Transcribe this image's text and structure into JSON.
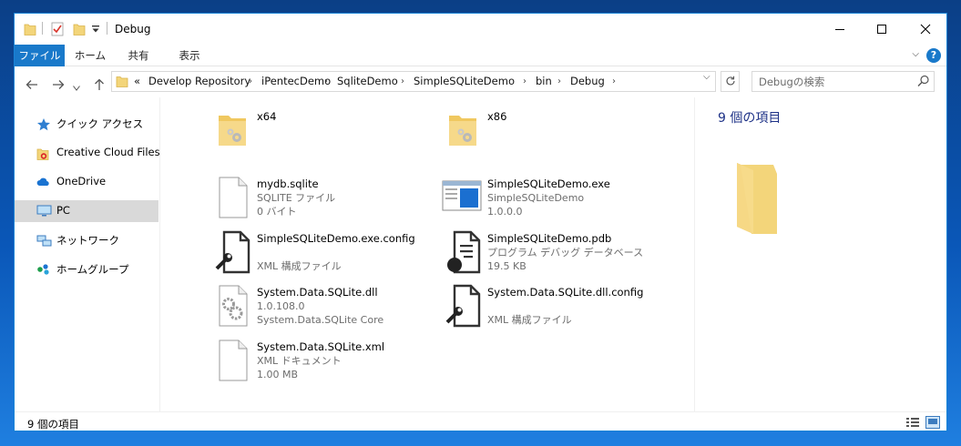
{
  "window": {
    "title": "Debug"
  },
  "ribbon": {
    "tabs": [
      "ファイル",
      "ホーム",
      "共有",
      "表示"
    ],
    "help": "?"
  },
  "address": {
    "overflow": "«",
    "crumbs": [
      "Develop Repository",
      "iPentecDemo",
      "SqliteDemo",
      "SimpleSQLiteDemo",
      "bin",
      "Debug"
    ]
  },
  "search": {
    "placeholder": "Debugの検索"
  },
  "nav": {
    "items": [
      {
        "label": "クイック アクセス",
        "icon": "star-icon"
      },
      {
        "label": "Creative Cloud Files",
        "icon": "creative-cloud-icon"
      },
      {
        "label": "OneDrive",
        "icon": "cloud-icon"
      },
      {
        "label": "PC",
        "icon": "computer-icon"
      },
      {
        "label": "ネットワーク",
        "icon": "network-icon"
      },
      {
        "label": "ホームグループ",
        "icon": "homegroup-icon"
      }
    ]
  },
  "files": [
    {
      "name": "x64",
      "line2": "",
      "line3": "",
      "icon": "folder-gear-icon"
    },
    {
      "name": "x86",
      "line2": "",
      "line3": "",
      "icon": "folder-gear-icon"
    },
    {
      "name": "mydb.sqlite",
      "line2": "SQLITE ファイル",
      "line3": "0 バイト",
      "icon": "blank-file-icon"
    },
    {
      "name": "SimpleSQLiteDemo.exe",
      "line2": "SimpleSQLiteDemo",
      "line3": "1.0.0.0",
      "icon": "exe-window-icon"
    },
    {
      "name": "SimpleSQLiteDemo.exe.config",
      "line2": "XML 構成ファイル",
      "line3": "",
      "icon": "config-file-icon"
    },
    {
      "name": "SimpleSQLiteDemo.pdb",
      "line2": "プログラム デバッグ データベース",
      "line3": "19.5 KB",
      "icon": "pdb-file-icon"
    },
    {
      "name": "System.Data.SQLite.dll",
      "line2": "1.0.108.0",
      "line3": "System.Data.SQLite Core",
      "icon": "dll-file-icon"
    },
    {
      "name": "System.Data.SQLite.dll.config",
      "line2": "XML 構成ファイル",
      "line3": "",
      "icon": "config-file-icon"
    },
    {
      "name": "System.Data.SQLite.xml",
      "line2": "XML ドキュメント",
      "line3": "1.00 MB",
      "icon": "blank-file-icon"
    }
  ],
  "preview": {
    "title": "9 個の項目"
  },
  "status": {
    "text": "9 個の項目"
  }
}
